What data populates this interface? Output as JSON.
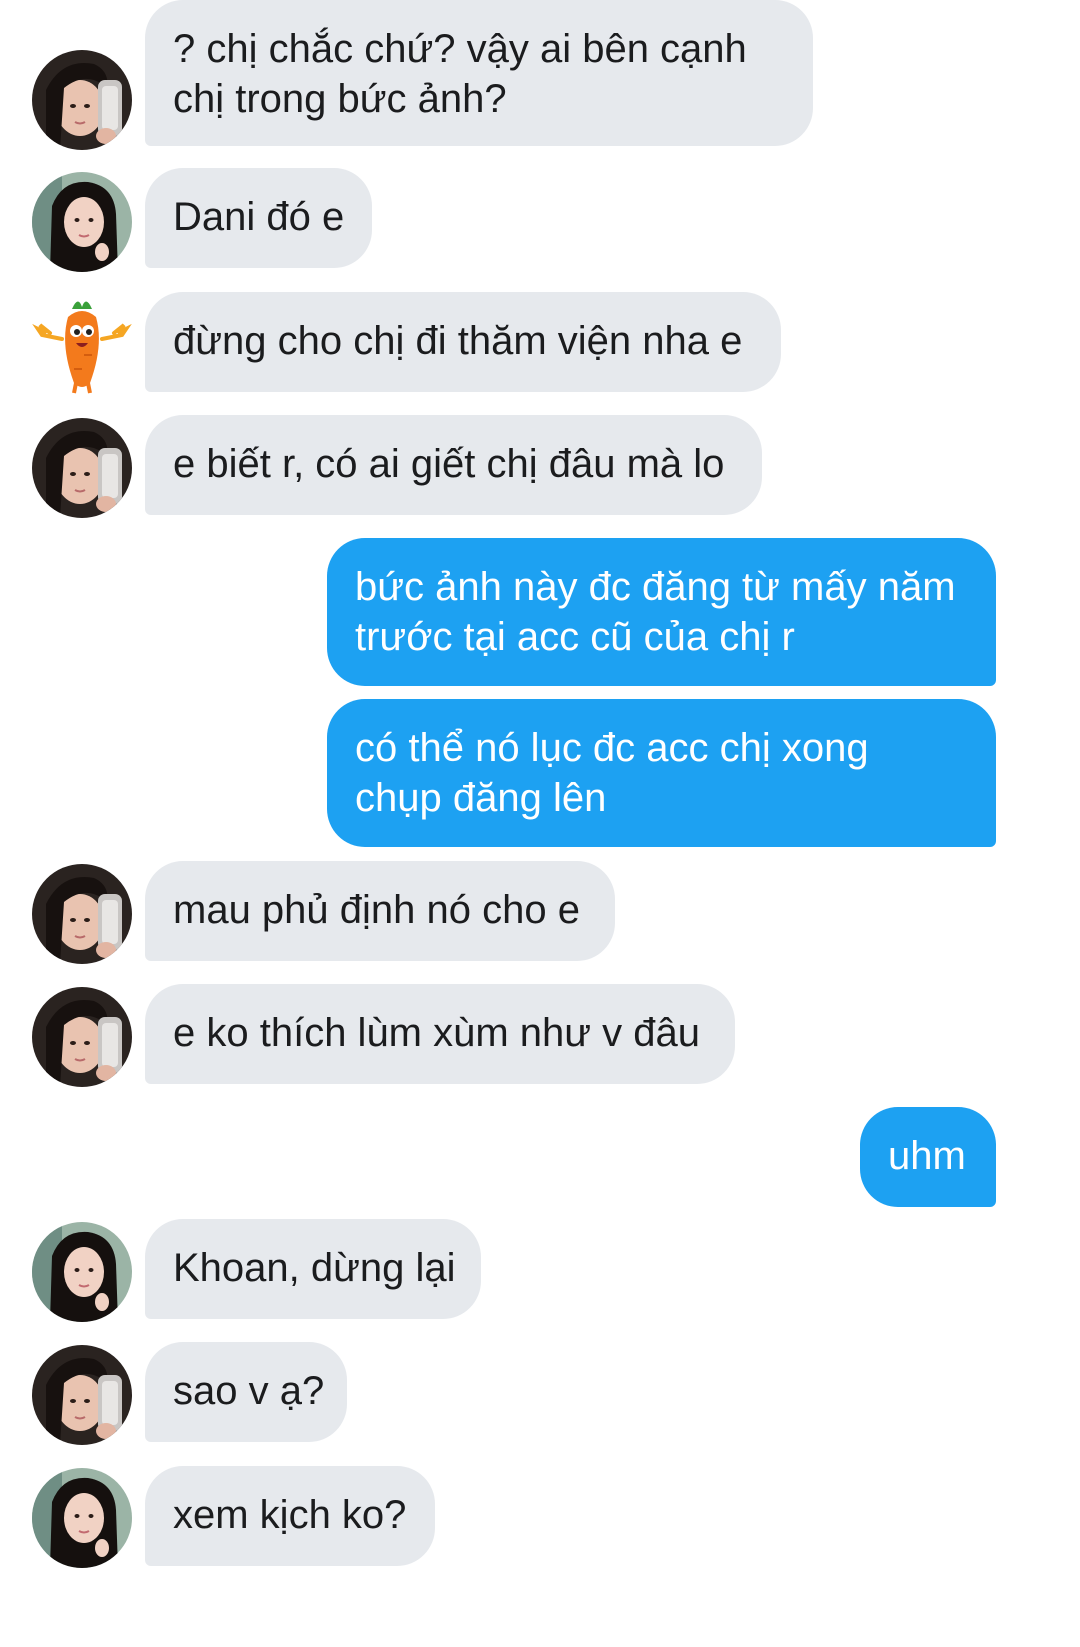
{
  "colors": {
    "incoming_bubble": "#e6e9ed",
    "outgoing_bubble": "#1da1f2",
    "incoming_text": "#1b1c1e",
    "outgoing_text": "#ffffff"
  },
  "messages": [
    {
      "side": "in",
      "avatar": "avatar-dark-hair-selfie-icon",
      "lines": [
        "? chị chắc chứ? vậy ai bên cạnh",
        "chị trong bức ảnh?"
      ]
    },
    {
      "side": "in",
      "avatar": "avatar-long-hair-portrait-icon",
      "lines": [
        "Dani đó e"
      ]
    },
    {
      "side": "in",
      "avatar": "avatar-carrot-mascot-icon",
      "lines": [
        "đừng cho chị đi thăm viện nha e"
      ]
    },
    {
      "side": "in",
      "avatar": "avatar-dark-hair-selfie-icon",
      "lines": [
        "e biết r, có ai giết chị đâu mà lo"
      ]
    },
    {
      "side": "out",
      "lines": [
        "bức ảnh này đc đăng từ mấy năm",
        "trước tại acc cũ của chị r"
      ]
    },
    {
      "side": "out",
      "lines": [
        "có thể nó lục đc acc chị xong",
        "chụp đăng lên"
      ]
    },
    {
      "side": "in",
      "avatar": "avatar-dark-hair-selfie-icon",
      "lines": [
        "mau phủ định nó cho e"
      ]
    },
    {
      "side": "in",
      "avatar": "avatar-dark-hair-selfie-icon",
      "lines": [
        "e ko thích lùm xùm như v đâu"
      ]
    },
    {
      "side": "out",
      "lines": [
        "uhm"
      ]
    },
    {
      "side": "in",
      "avatar": "avatar-long-hair-portrait-icon",
      "lines": [
        "Khoan, dừng lại"
      ]
    },
    {
      "side": "in",
      "avatar": "avatar-dark-hair-selfie-icon",
      "lines": [
        "sao v ạ?"
      ]
    },
    {
      "side": "in",
      "avatar": "avatar-long-hair-portrait-icon",
      "lines": [
        "xem kịch ko?"
      ]
    }
  ]
}
